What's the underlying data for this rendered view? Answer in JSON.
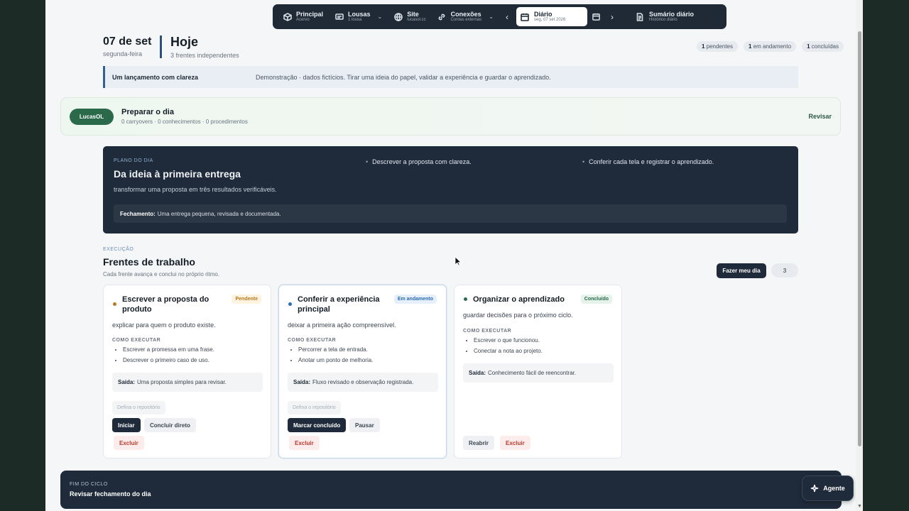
{
  "nav": {
    "items": [
      {
        "title": "Principal",
        "sub": "Acervo"
      },
      {
        "title": "Lousas",
        "sub": "1 lousa"
      },
      {
        "title": "Site",
        "sub": "lucasol.cc"
      },
      {
        "title": "Conexões",
        "sub": "Contas externas"
      },
      {
        "title": "Diário",
        "sub": "seg, 07 set 2026"
      },
      {
        "title": "Sumário diário",
        "sub": "Histórico diário"
      }
    ]
  },
  "header": {
    "date": "07 de set",
    "weekday": "segunda-feira",
    "title": "Hoje",
    "subtitle": "3 frentes independentes",
    "counters": [
      {
        "num": "1",
        "label": "pendentes"
      },
      {
        "num": "1",
        "label": "em andamento"
      },
      {
        "num": "1",
        "label": "concluídas"
      }
    ]
  },
  "banner": {
    "title": "Um lançamento com clareza",
    "desc": "Demonstração · dados fictícios. Tirar uma ideia do papel, validar a experiência e guardar o aprendizado."
  },
  "prep": {
    "pill": "LucasOL",
    "title": "Preparar o dia",
    "meta": "0 carryovers · 0 conhecimentos · 0 procedimentos",
    "action": "Revisar"
  },
  "plan": {
    "kicker": "PLANO DO DIA",
    "title": "Da ideia à primeira entrega",
    "subtitle": "transformar uma proposta em três resultados verificáveis.",
    "bullets": [
      "Descrever a proposta com clareza.",
      "Conferir cada tela e registrar o aprendizado."
    ],
    "closing_label": "Fechamento:",
    "closing_text": "Uma entrega pequena, revisada e documentada."
  },
  "exec": {
    "kicker": "EXECUÇÃO",
    "title": "Frentes de trabalho",
    "subtitle": "Cada frente avança e conclui no próprio ritmo.",
    "myday": "Fazer meu dia",
    "count": "3"
  },
  "how_label": "COMO EXECUTAR",
  "out_label": "Saída:",
  "cards": [
    {
      "title": "Escrever a proposta do produto",
      "badge": "Pendente",
      "desc": "explicar para quem o produto existe.",
      "steps": [
        "Escrever a promessa em uma frase.",
        "Descrever o primeiro caso de uso."
      ],
      "output": "Uma proposta simples para revisar.",
      "repo": "Defina o repositório",
      "primary": "Iniciar",
      "secondary": "Concluir direto",
      "delete": "Excluir"
    },
    {
      "title": "Conferir a experiência principal",
      "badge": "Em andamento",
      "desc": "deixar a primeira ação compreensível.",
      "steps": [
        "Percorrer a tela de entrada.",
        "Anotar um ponto de melhoria."
      ],
      "output": "Fluxo revisado e observação registrada.",
      "repo": "Defina o repositório",
      "primary": "Marcar concluído",
      "secondary": "Pausar",
      "delete": "Excluir"
    },
    {
      "title": "Organizar o aprendizado",
      "badge": "Concluído",
      "desc": "guardar decisões para o próximo ciclo.",
      "steps": [
        "Escrever o que funcionou.",
        "Conectar a nota ao projeto."
      ],
      "output": "Conhecimento fácil de reencontrar.",
      "secondary": "Reabrir",
      "delete": "Excluir"
    }
  ],
  "footer": {
    "kicker": "FIM DO CICLO",
    "title": "Revisar fechamento do dia"
  },
  "agent": "Agente",
  "colors": {
    "pending": "#b7791f",
    "progress": "#2b6cb0",
    "done": "#2a6a4b",
    "dark": "#1f2a3a"
  }
}
